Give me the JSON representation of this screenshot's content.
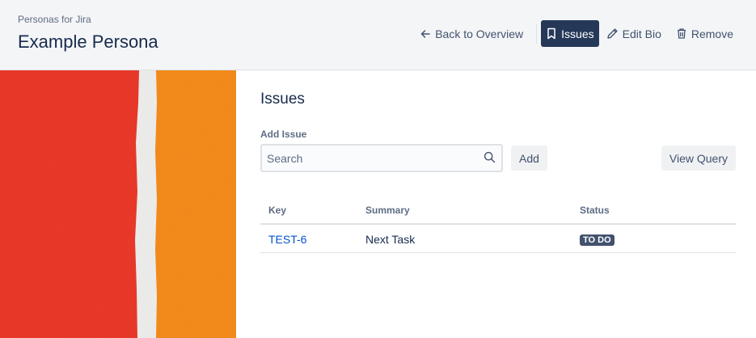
{
  "header": {
    "app_name": "Personas for Jira",
    "title": "Example Persona",
    "actions": {
      "back": "Back to Overview",
      "issues": "Issues",
      "edit_bio": "Edit Bio",
      "remove": "Remove"
    }
  },
  "art": {
    "colors": [
      "#f03a2a",
      "#f4f4f2",
      "#fb8f1c"
    ]
  },
  "main": {
    "section_title": "Issues",
    "add_issue_label": "Add Issue",
    "search": {
      "placeholder": "Search",
      "value": ""
    },
    "add_button": "Add",
    "view_query_button": "View Query",
    "table": {
      "headers": {
        "key": "Key",
        "summary": "Summary",
        "status": "Status"
      },
      "rows": [
        {
          "key": "TEST-6",
          "summary": "Next Task",
          "status": "TO DO"
        }
      ]
    }
  },
  "colors": {
    "active_button": "#253858",
    "link": "#0052cc",
    "lozenge": "#42526e"
  }
}
